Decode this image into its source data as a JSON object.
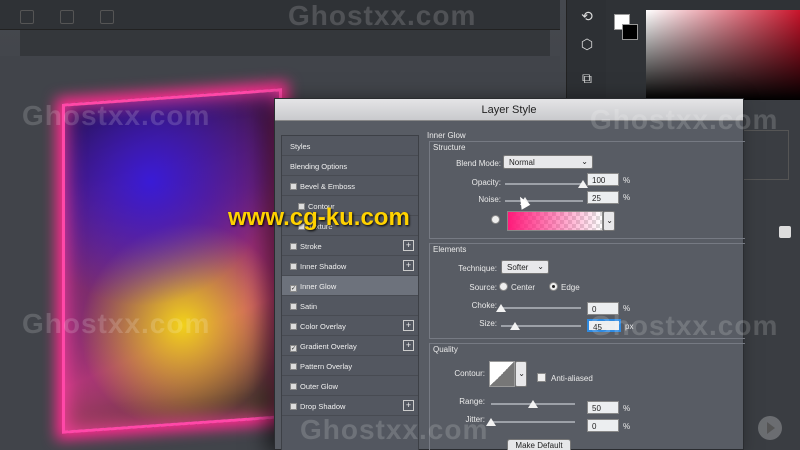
{
  "dialog": {
    "title": "Layer Style"
  },
  "styles_list": {
    "header": "Styles",
    "items": [
      {
        "label": "Blending Options",
        "checkbox": false,
        "checked": false,
        "plus": false,
        "indent": false,
        "selected": false
      },
      {
        "label": "Bevel & Emboss",
        "checkbox": true,
        "checked": false,
        "plus": false,
        "indent": false,
        "selected": false
      },
      {
        "label": "Contour",
        "checkbox": true,
        "checked": false,
        "plus": false,
        "indent": true,
        "selected": false
      },
      {
        "label": "Texture",
        "checkbox": true,
        "checked": false,
        "plus": false,
        "indent": true,
        "selected": false
      },
      {
        "label": "Stroke",
        "checkbox": true,
        "checked": false,
        "plus": true,
        "indent": false,
        "selected": false
      },
      {
        "label": "Inner Shadow",
        "checkbox": true,
        "checked": false,
        "plus": true,
        "indent": false,
        "selected": false
      },
      {
        "label": "Inner Glow",
        "checkbox": true,
        "checked": true,
        "plus": false,
        "indent": false,
        "selected": true
      },
      {
        "label": "Satin",
        "checkbox": true,
        "checked": false,
        "plus": false,
        "indent": false,
        "selected": false
      },
      {
        "label": "Color Overlay",
        "checkbox": true,
        "checked": false,
        "plus": true,
        "indent": false,
        "selected": false
      },
      {
        "label": "Gradient Overlay",
        "checkbox": true,
        "checked": true,
        "plus": true,
        "indent": false,
        "selected": false
      },
      {
        "label": "Pattern Overlay",
        "checkbox": true,
        "checked": false,
        "plus": false,
        "indent": false,
        "selected": false
      },
      {
        "label": "Outer Glow",
        "checkbox": true,
        "checked": false,
        "plus": false,
        "indent": false,
        "selected": false
      },
      {
        "label": "Drop Shadow",
        "checkbox": true,
        "checked": false,
        "plus": true,
        "indent": false,
        "selected": false
      }
    ]
  },
  "inner_glow": {
    "section_title": "Inner Glow",
    "structure": {
      "title": "Structure",
      "blend_mode_label": "Blend Mode:",
      "blend_mode_value": "Normal",
      "opacity_label": "Opacity:",
      "opacity_value": "100",
      "opacity_fraction": 1.0,
      "noise_label": "Noise:",
      "noise_value": "25",
      "noise_fraction": 0.25,
      "percent": "%"
    },
    "elements": {
      "title": "Elements",
      "technique_label": "Technique:",
      "technique_value": "Softer",
      "source_label": "Source:",
      "source_center": "Center",
      "source_edge": "Edge",
      "choke_label": "Choke:",
      "choke_value": "0",
      "choke_fraction": 0,
      "size_label": "Size:",
      "size_value": "45",
      "size_fraction": 0.18,
      "percent": "%",
      "px": "px"
    },
    "quality": {
      "title": "Quality",
      "contour_label": "Contour:",
      "anti_aliased_label": "Anti-aliased",
      "range_label": "Range:",
      "range_value": "50",
      "range_fraction": 0.5,
      "jitter_label": "Jitter:",
      "jitter_value": "0",
      "jitter_fraction": 0,
      "percent": "%"
    },
    "make_default_label": "Make Default"
  },
  "watermarks": {
    "brand": "Ghostxx.com",
    "site": "www.cg-ku.com"
  },
  "colors": {
    "glow_pink": "#ff1a7a",
    "accent_focus": "#2f8ae0"
  }
}
